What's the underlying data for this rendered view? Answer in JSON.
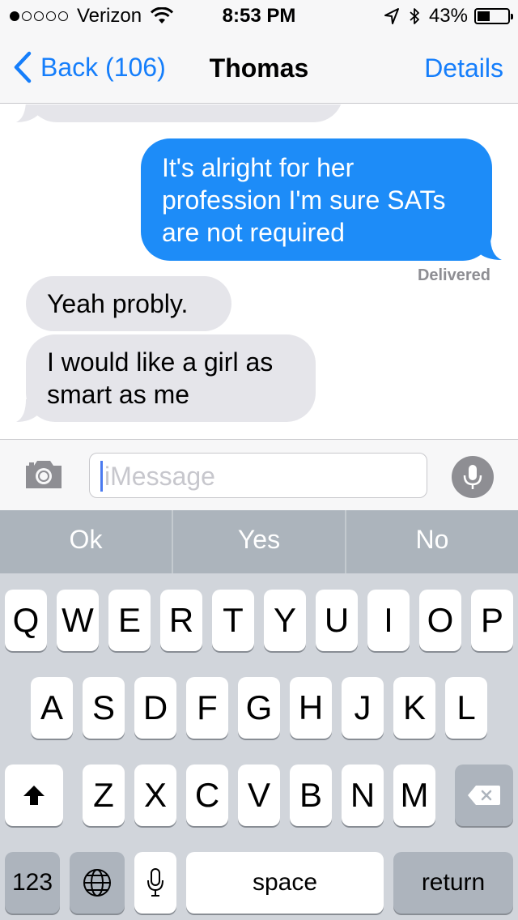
{
  "status_bar": {
    "carrier": "Verizon",
    "signal_dots_filled": 1,
    "signal_dots_total": 5,
    "time": "8:53 PM",
    "battery_percent": "43%",
    "battery_level": 0.43,
    "icons": [
      "wifi-icon",
      "location-arrow-icon",
      "bluetooth-icon",
      "battery-icon"
    ]
  },
  "nav": {
    "back_label": "Back (106)",
    "title": "Thomas",
    "details_label": "Details"
  },
  "messages": [
    {
      "direction": "incoming",
      "text": "",
      "partially_visible": true
    },
    {
      "direction": "outgoing",
      "lines": [
        "It's alright for her",
        "profession I'm sure SATs",
        "are not required"
      ]
    },
    {
      "direction": "incoming",
      "lines": [
        "Yeah probly."
      ]
    },
    {
      "direction": "incoming",
      "lines": [
        "I would like a girl as",
        "smart as me"
      ]
    }
  ],
  "delivered_label": "Delivered",
  "input": {
    "placeholder": "iMessage",
    "value": ""
  },
  "suggestions": [
    "Ok",
    "Yes",
    "No"
  ],
  "keyboard": {
    "row1": [
      "Q",
      "W",
      "E",
      "R",
      "T",
      "Y",
      "U",
      "I",
      "O",
      "P"
    ],
    "row2": [
      "A",
      "S",
      "D",
      "F",
      "G",
      "H",
      "J",
      "K",
      "L"
    ],
    "row3": [
      "Z",
      "X",
      "C",
      "V",
      "B",
      "N",
      "M"
    ],
    "numbers_label": "123",
    "space_label": "space",
    "return_label": "return"
  },
  "colors": {
    "accent": "#157efb",
    "outgoing_bubble": "#1d8cf8",
    "incoming_bubble": "#e5e5ea",
    "keyboard_bg": "#d1d5db",
    "suggestion_bar": "#acb4bc"
  }
}
